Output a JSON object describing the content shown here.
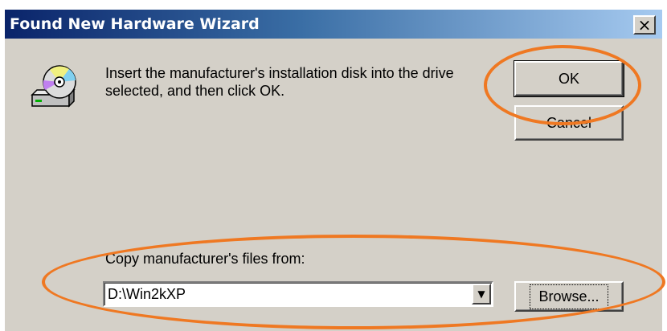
{
  "window": {
    "title": "Found New Hardware Wizard",
    "close_symbol": "×",
    "close_icon": "close-icon"
  },
  "icon": {
    "name": "installation-disk-icon"
  },
  "message": {
    "line1": "Insert the manufacturer's installation disk into the drive",
    "line2": "selected, and then click OK."
  },
  "buttons": {
    "ok": "OK",
    "cancel": "Cancel",
    "browse": "Browse..."
  },
  "copy_from": {
    "label": "Copy manufacturer's files from:",
    "value": "D:\\Win2kXP",
    "dropdown_symbol": "▼"
  },
  "annotations": {
    "color": "#ef7822"
  },
  "colors": {
    "dialog_bg": "#d4d0c8",
    "title_start": "#0a246a",
    "title_end": "#a6caf0"
  }
}
